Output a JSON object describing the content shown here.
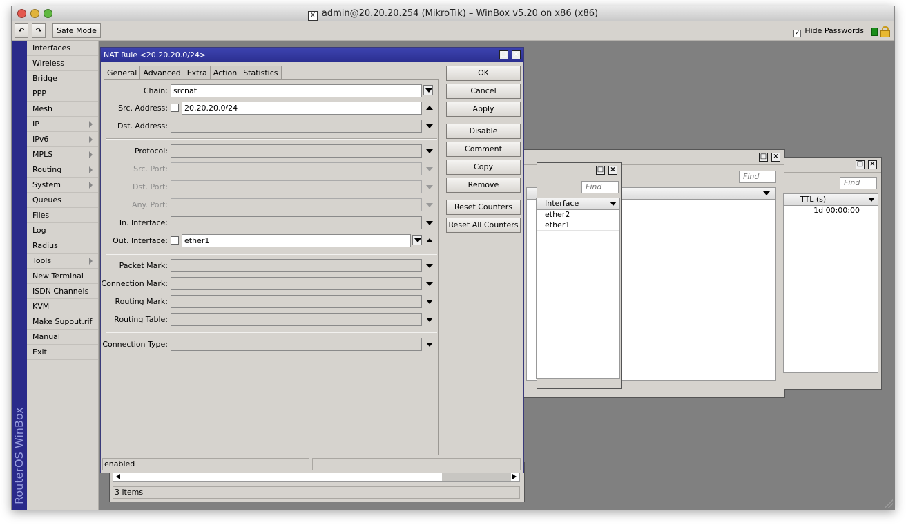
{
  "window": {
    "title": "admin@20.20.20.254 (MikroTik) – WinBox v5.20 on x86 (x86)"
  },
  "toolbar": {
    "safe_mode_label": "Safe Mode",
    "hide_passwords_label": "Hide Passwords",
    "hide_passwords_checked": true
  },
  "sidebar": {
    "brand": "RouterOS WinBox",
    "items": [
      {
        "label": "Interfaces",
        "submenu": false
      },
      {
        "label": "Wireless",
        "submenu": false
      },
      {
        "label": "Bridge",
        "submenu": false
      },
      {
        "label": "PPP",
        "submenu": false
      },
      {
        "label": "Mesh",
        "submenu": false
      },
      {
        "label": "IP",
        "submenu": true
      },
      {
        "label": "IPv6",
        "submenu": true
      },
      {
        "label": "MPLS",
        "submenu": true
      },
      {
        "label": "Routing",
        "submenu": true
      },
      {
        "label": "System",
        "submenu": true
      },
      {
        "label": "Queues",
        "submenu": false
      },
      {
        "label": "Files",
        "submenu": false
      },
      {
        "label": "Log",
        "submenu": false
      },
      {
        "label": "Radius",
        "submenu": false
      },
      {
        "label": "Tools",
        "submenu": true
      },
      {
        "label": "New Terminal",
        "submenu": false
      },
      {
        "label": "ISDN Channels",
        "submenu": false
      },
      {
        "label": "KVM",
        "submenu": false
      },
      {
        "label": "Make Supout.rif",
        "submenu": false
      },
      {
        "label": "Manual",
        "submenu": false
      },
      {
        "label": "Exit",
        "submenu": false
      }
    ]
  },
  "bg_windows": {
    "find_placeholder": "Find",
    "interfaces_list": {
      "column": "Interface",
      "rows": [
        "ether2",
        "ether1"
      ]
    },
    "ttl_list": {
      "column": "TTL (s)",
      "rows": [
        "1d 00:00:00"
      ]
    },
    "items_count": "3 items"
  },
  "nat_rule": {
    "title": "NAT Rule <20.20.20.0/24>",
    "tabs": [
      "General",
      "Advanced",
      "Extra",
      "Action",
      "Statistics"
    ],
    "active_tab": "General",
    "fields": {
      "chain": {
        "label": "Chain:",
        "value": "srcnat"
      },
      "src_address": {
        "label": "Src. Address:",
        "value": "20.20.20.0/24"
      },
      "dst_address": {
        "label": "Dst. Address:",
        "value": ""
      },
      "protocol": {
        "label": "Protocol:",
        "value": ""
      },
      "src_port": {
        "label": "Src. Port:",
        "value": ""
      },
      "dst_port": {
        "label": "Dst. Port:",
        "value": ""
      },
      "any_port": {
        "label": "Any. Port:",
        "value": ""
      },
      "in_interface": {
        "label": "In. Interface:",
        "value": ""
      },
      "out_interface": {
        "label": "Out. Interface:",
        "value": "ether1"
      },
      "packet_mark": {
        "label": "Packet Mark:",
        "value": ""
      },
      "connection_mark": {
        "label": "Connection Mark:",
        "value": ""
      },
      "routing_mark": {
        "label": "Routing Mark:",
        "value": ""
      },
      "routing_table": {
        "label": "Routing Table:",
        "value": ""
      },
      "connection_type": {
        "label": "Connection Type:",
        "value": ""
      }
    },
    "buttons": [
      "OK",
      "Cancel",
      "Apply",
      "Disable",
      "Comment",
      "Copy",
      "Remove",
      "Reset Counters",
      "Reset All Counters"
    ],
    "status": "enabled"
  }
}
